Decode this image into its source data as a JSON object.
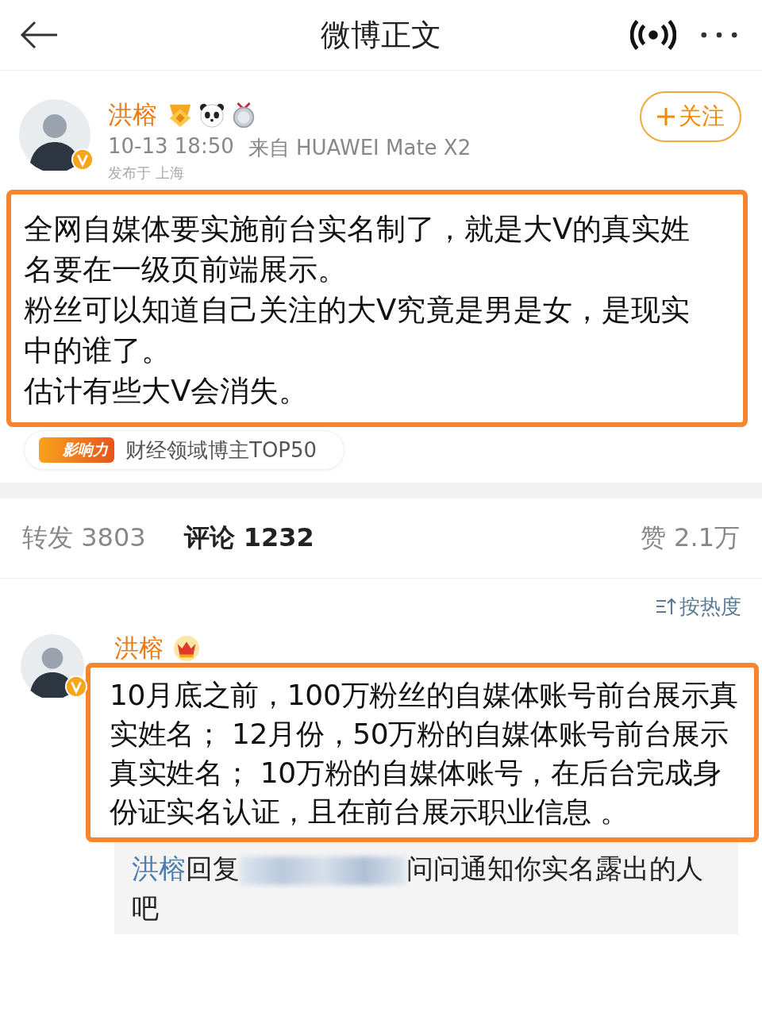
{
  "header": {
    "title": "微博正文"
  },
  "post": {
    "author": "洪榕",
    "verified": true,
    "time": "10-13 18:50",
    "source": "来自 HUAWEI Mate X2",
    "location": "发布于 上海",
    "follow_label": "关注",
    "paragraphs": [
      "全网自媒体要实施前台实名制了，就是大V的真实姓名要在一级页前端展示。",
      "粉丝可以知道自己关注的大V究竟是男是女，是现实中的谁了。",
      "估计有些大V会消失。"
    ],
    "tag": {
      "badge": "影响力",
      "text": "财经领域博主TOP50"
    }
  },
  "stats": [
    {
      "label": "转发",
      "count": "3803",
      "selected": false
    },
    {
      "label": "评论",
      "count": "1232",
      "selected": true
    },
    {
      "label": "赞",
      "count": "2.1万",
      "selected": false
    }
  ],
  "sort": {
    "label": "按热度"
  },
  "comment": {
    "author": "洪榕",
    "verified": true,
    "text": "10月底之前，100万粉丝的自媒体账号前台展示真实姓名； 12月份，50万粉的自媒体账号前台展示真实姓名； 10万粉的自媒体账号，在后台完成身份证实名认证，且在前台展示职业信息 。",
    "reply": {
      "author": "洪榕",
      "verb": "回复",
      "text": "问问通知你实名露出的人吧"
    }
  }
}
